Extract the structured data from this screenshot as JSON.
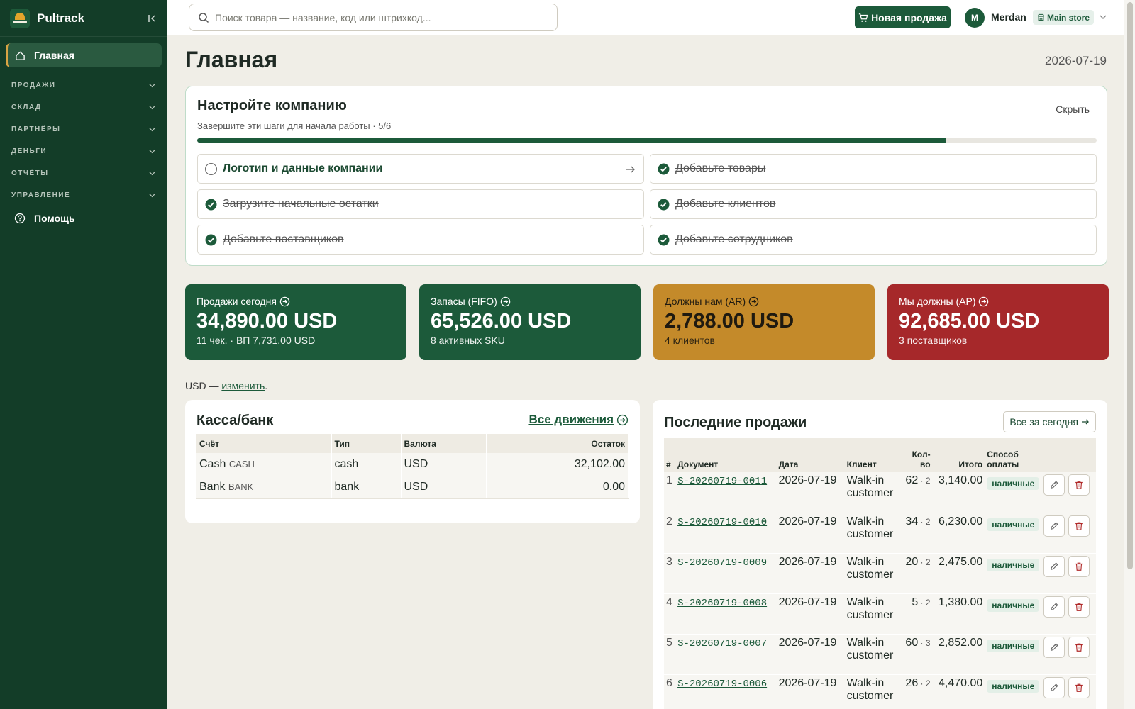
{
  "app": {
    "name": "Pultrack"
  },
  "sidebar": {
    "active": "Главная",
    "sections": [
      "ПРОДАЖИ",
      "СКЛАД",
      "ПАРТНЁРЫ",
      "ДЕНЬГИ",
      "ОТЧЁТЫ",
      "УПРАВЛЕНИЕ"
    ],
    "help": "Помощь"
  },
  "topbar": {
    "search_placeholder": "Поиск товара — название, код или штрихкод...",
    "new_sale": "Новая продажа",
    "avatar_initial": "M",
    "user_name": "Merdan",
    "store": "Main store"
  },
  "page": {
    "title": "Главная",
    "date": "2026-07-19"
  },
  "setup": {
    "title": "Настройте компанию",
    "subtitle": "Завершите эти шаги для начала работы · 5/6",
    "hide": "Скрыть",
    "progress_fraction": 0.833,
    "items": [
      {
        "label": "Логотип и данные компании",
        "done": false
      },
      {
        "label": "Добавьте товары",
        "done": true
      },
      {
        "label": "Загрузите начальные остатки",
        "done": true
      },
      {
        "label": "Добавьте клиентов",
        "done": true
      },
      {
        "label": "Добавьте поставщиков",
        "done": true
      },
      {
        "label": "Добавьте сотрудников",
        "done": true
      }
    ]
  },
  "kpis": [
    {
      "label": "Продажи сегодня",
      "value": "34,890.00 USD",
      "sub": "11 чек. · ВП 7,731.00 USD",
      "color": "#1c5a3a"
    },
    {
      "label": "Запасы (FIFO)",
      "value": "65,526.00 USD",
      "sub": "8 активных SKU",
      "color": "#1c5a3a"
    },
    {
      "label": "Должны нам (AR)",
      "value": "2,788.00 USD",
      "sub": "4 клиентов",
      "color": "#c48a2a"
    },
    {
      "label": "Мы должны (AP)",
      "value": "92,685.00 USD",
      "sub": "3 поставщиков",
      "color": "#a6282a"
    }
  ],
  "currency_note": {
    "prefix": "USD — ",
    "link": "изменить",
    "suffix": "."
  },
  "cash": {
    "title": "Касса/банк",
    "link": "Все движения",
    "headers": [
      "Счёт",
      "Тип",
      "Валюта",
      "Остаток"
    ],
    "rows": [
      {
        "name": "Cash",
        "code": "CASH",
        "type": "cash",
        "currency": "USD",
        "balance": "32,102.00"
      },
      {
        "name": "Bank",
        "code": "BANK",
        "type": "bank",
        "currency": "USD",
        "balance": "0.00"
      }
    ]
  },
  "sales": {
    "title": "Последние продажи",
    "link": "Все за сегодня",
    "headers": {
      "num": "#",
      "doc": "Документ",
      "date": "Дата",
      "client": "Клиент",
      "qty": "Кол-во",
      "total": "Итого",
      "payment": "Способ оплаты"
    },
    "rows": [
      {
        "n": "1",
        "doc": "S-20260719-0011",
        "date": "2026-07-19",
        "client": "Walk-in customer",
        "qty": "62",
        "lines": "2",
        "total": "3,140.00",
        "payment": "наличные"
      },
      {
        "n": "2",
        "doc": "S-20260719-0010",
        "date": "2026-07-19",
        "client": "Walk-in customer",
        "qty": "34",
        "lines": "2",
        "total": "6,230.00",
        "payment": "наличные"
      },
      {
        "n": "3",
        "doc": "S-20260719-0009",
        "date": "2026-07-19",
        "client": "Walk-in customer",
        "qty": "20",
        "lines": "2",
        "total": "2,475.00",
        "payment": "наличные"
      },
      {
        "n": "4",
        "doc": "S-20260719-0008",
        "date": "2026-07-19",
        "client": "Walk-in customer",
        "qty": "5",
        "lines": "2",
        "total": "1,380.00",
        "payment": "наличные"
      },
      {
        "n": "5",
        "doc": "S-20260719-0007",
        "date": "2026-07-19",
        "client": "Walk-in customer",
        "qty": "60",
        "lines": "3",
        "total": "2,852.00",
        "payment": "наличные"
      },
      {
        "n": "6",
        "doc": "S-20260719-0006",
        "date": "2026-07-19",
        "client": "Walk-in customer",
        "qty": "26",
        "lines": "2",
        "total": "4,470.00",
        "payment": "наличные"
      }
    ]
  }
}
